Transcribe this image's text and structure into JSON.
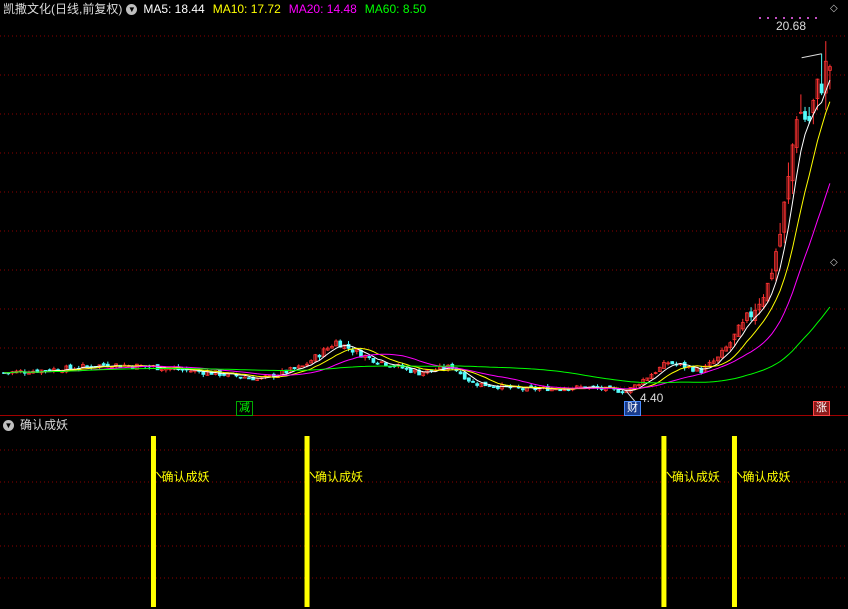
{
  "header": {
    "title": "凯撒文化(日线,前复权)",
    "ma": [
      {
        "label": "MA5: 18.44",
        "color": "#ffffff"
      },
      {
        "label": "MA10: 17.72",
        "color": "#ffff00"
      },
      {
        "label": "MA20: 14.48",
        "color": "#ff00ff"
      },
      {
        "label": "MA60: 8.50",
        "color": "#00ff00"
      }
    ]
  },
  "annotations": {
    "high_label": "20.68",
    "low_label": "4.40",
    "tag_jian": "减",
    "tag_cai": "财",
    "tag_zhang": "涨"
  },
  "indicator": {
    "title": "确认成妖",
    "signal_label": "确认成妖"
  },
  "colors": {
    "up": "#ff3232",
    "down": "#54fcfc",
    "ma5": "#ffffff",
    "ma10": "#ffff00",
    "ma20": "#ff00ff",
    "ma60": "#00ff00",
    "signal": "#ffff00",
    "grid": "#8b0000"
  },
  "chart_data": [
    {
      "type": "candlestick",
      "title": "凯撒文化(日线,前复权)",
      "ylim": [
        3.6,
        22.5
      ],
      "days": 200,
      "price_path": [
        [
          0,
          5.3
        ],
        [
          15,
          5.5
        ],
        [
          25,
          5.7
        ],
        [
          35,
          5.6
        ],
        [
          50,
          5.3
        ],
        [
          62,
          5.0
        ],
        [
          72,
          5.6
        ],
        [
          80,
          6.8
        ],
        [
          88,
          6.0
        ],
        [
          100,
          5.3
        ],
        [
          108,
          5.6
        ],
        [
          113,
          4.8
        ],
        [
          125,
          4.5
        ],
        [
          140,
          4.6
        ],
        [
          150,
          4.4
        ],
        [
          160,
          5.8
        ],
        [
          168,
          5.4
        ],
        [
          172,
          6.0
        ],
        [
          178,
          7.5
        ],
        [
          184,
          9.5
        ],
        [
          187,
          12.0
        ],
        [
          189,
          14.5
        ],
        [
          191,
          18.0
        ],
        [
          194,
          17.5
        ],
        [
          197,
          19.5
        ],
        [
          199,
          20.2
        ]
      ],
      "high": 20.68,
      "low": 4.4,
      "ma_series": [
        {
          "name": "MA5",
          "value": 18.44
        },
        {
          "name": "MA10",
          "value": 17.72
        },
        {
          "name": "MA20",
          "value": 14.48
        },
        {
          "name": "MA60",
          "value": 8.5
        }
      ]
    },
    {
      "type": "bar",
      "title": "确认成妖",
      "signal_days": [
        36,
        73,
        159,
        176
      ],
      "ylim": [
        0,
        1
      ],
      "values": [
        1,
        1,
        1,
        1
      ]
    }
  ]
}
